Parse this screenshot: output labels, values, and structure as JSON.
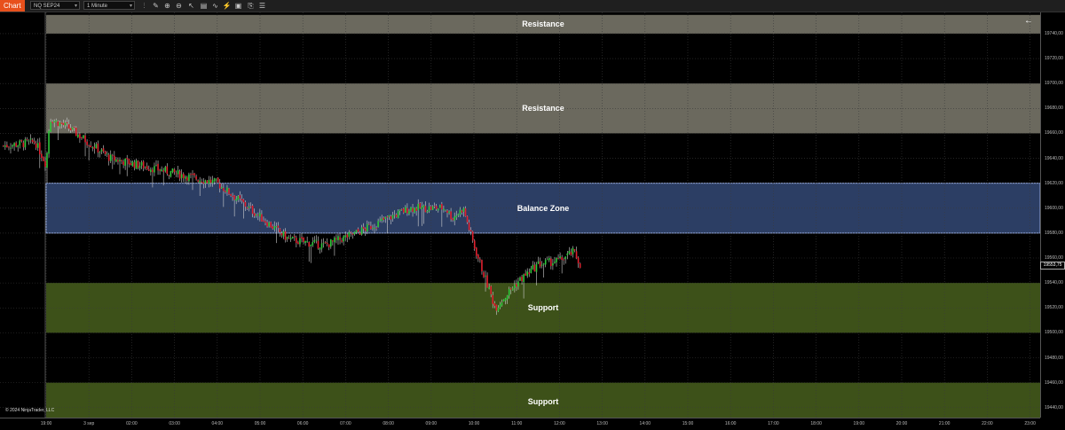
{
  "toolbar": {
    "tab_label": "Chart",
    "instrument": "NQ SEP24",
    "interval": "1 Minute",
    "icons": [
      "bar-type-icon",
      "draw-tools-icon",
      "zoom-in-icon",
      "zoom-out-icon",
      "templates-icon",
      "properties-icon",
      "indicators-icon",
      "strategies-icon",
      "data-box-icon",
      "chart-trader-icon"
    ]
  },
  "chart": {
    "copyright": "© 2024 NinjaTrader, LLC",
    "back_arrow": "←",
    "current_price": "19553,75",
    "zones": [
      {
        "label": "Resistance",
        "top": 19755,
        "bottom": 19740,
        "color": "#6b695e"
      },
      {
        "label": "Resistance",
        "top": 19700,
        "bottom": 19660,
        "color": "#6b695e"
      },
      {
        "label": "Balance Zone",
        "top": 19620,
        "bottom": 19580,
        "color": "#2c3e64",
        "border": "#8ea3d8"
      },
      {
        "label": "Support",
        "top": 19540,
        "bottom": 19500,
        "color": "#3d5119"
      },
      {
        "label": "Support",
        "top": 19460,
        "bottom": 19430,
        "color": "#3d5119"
      }
    ]
  },
  "chart_data": {
    "type": "candlestick",
    "y_axis_labels": [
      "19740,00",
      "19720,00",
      "19700,00",
      "19680,00",
      "19660,00",
      "19640,00",
      "19620,00",
      "19600,00",
      "19580,00",
      "19560,00",
      "19540,00",
      "19520,00",
      "19500,00",
      "19480,00",
      "19460,00",
      "19440,00"
    ],
    "ylim": [
      19432,
      19757
    ],
    "x_axis_labels": [
      "19:00",
      "3 sep",
      "02:00",
      "03:00",
      "04:00",
      "05:00",
      "06:00",
      "07:00",
      "08:00",
      "09:00",
      "10:00",
      "11:00",
      "12:00",
      "13:00",
      "14:00",
      "15:00",
      "16:00",
      "17:00",
      "18:00",
      "19:00",
      "20:00",
      "21:00",
      "22:00",
      "23:00"
    ],
    "price_path": [
      {
        "t": "18:00",
        "price": 19650
      },
      {
        "t": "18:45",
        "price": 19653
      },
      {
        "t": "19:00",
        "price": 19635
      },
      {
        "t": "19:05",
        "price": 19672
      },
      {
        "t": "19:30",
        "price": 19665
      },
      {
        "t": "20:30",
        "price": 19640
      },
      {
        "t": "23:00",
        "price": 19620
      },
      {
        "t": "00:40",
        "price": 19575
      },
      {
        "t": "01:30",
        "price": 19570
      },
      {
        "t": "02:15",
        "price": 19580
      },
      {
        "t": "03:30",
        "price": 19600
      },
      {
        "t": "04:20",
        "price": 19600
      },
      {
        "t": "04:30",
        "price": 19592
      },
      {
        "t": "04:45",
        "price": 19600
      },
      {
        "t": "05:00",
        "price": 19570
      },
      {
        "t": "05:30",
        "price": 19520
      },
      {
        "t": "06:00",
        "price": 19540
      },
      {
        "t": "06:30",
        "price": 19555
      },
      {
        "t": "07:00",
        "price": 19558
      },
      {
        "t": "07:20",
        "price": 19565
      },
      {
        "t": "07:30",
        "price": 19553.75
      }
    ]
  }
}
